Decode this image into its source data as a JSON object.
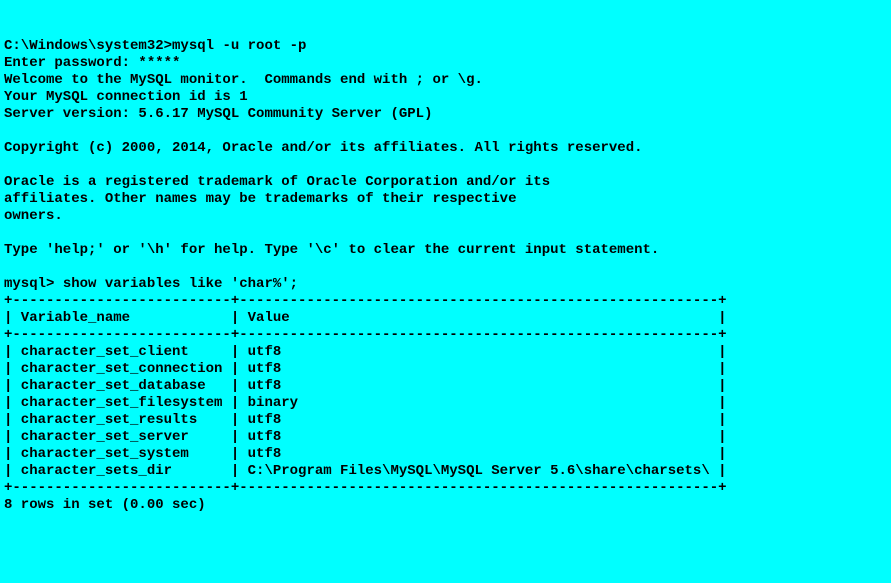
{
  "prompt1_path": "C:\\Windows\\system32>",
  "command1": "mysql -u root -p",
  "password_prompt": "Enter password: ",
  "password_mask": "*****",
  "welcome": "Welcome to the MySQL monitor.  Commands end with ; or \\g.",
  "connection_id": "Your MySQL connection id is 1",
  "server_version": "Server version: 5.6.17 MySQL Community Server (GPL)",
  "copyright": "Copyright (c) 2000, 2014, Oracle and/or its affiliates. All rights reserved.",
  "trademark1": "Oracle is a registered trademark of Oracle Corporation and/or its",
  "trademark2": "affiliates. Other names may be trademarks of their respective",
  "trademark3": "owners.",
  "help_line": "Type 'help;' or '\\h' for help. Type '\\c' to clear the current input statement.",
  "prompt2": "mysql> ",
  "command2": "show variables like 'char%';",
  "table_border_top": "+--------------------------+---------------------------------------------------------+",
  "table_header": "| Variable_name            | Value                                                   |",
  "table_border_mid": "+--------------------------+---------------------------------------------------------+",
  "rows": [
    "| character_set_client     | utf8                                                    |",
    "| character_set_connection | utf8                                                    |",
    "| character_set_database   | utf8                                                    |",
    "| character_set_filesystem | binary                                                  |",
    "| character_set_results    | utf8                                                    |",
    "| character_set_server     | utf8                                                    |",
    "| character_set_system     | utf8                                                    |",
    "| character_sets_dir       | C:\\Program Files\\MySQL\\MySQL Server 5.6\\share\\charsets\\ |"
  ],
  "table_border_bot": "+--------------------------+---------------------------------------------------------+",
  "result_count": "8 rows in set (0.00 sec)"
}
